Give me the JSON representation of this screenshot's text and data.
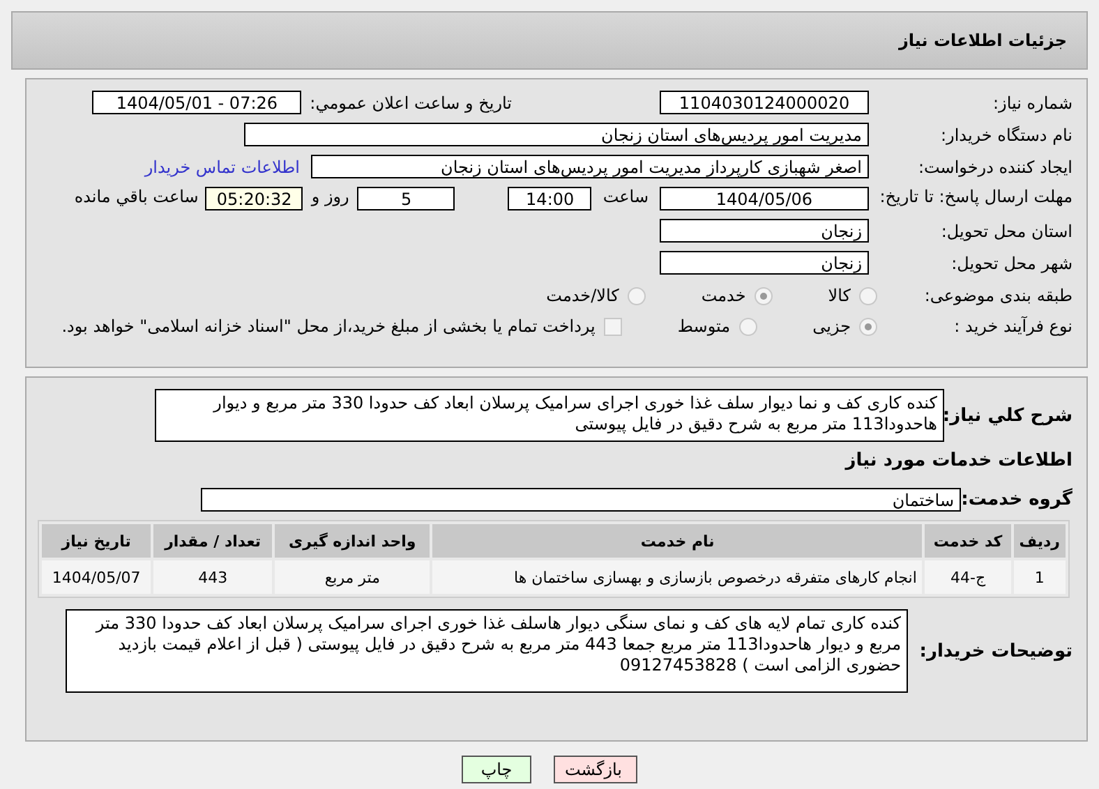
{
  "header": {
    "title": "جزئیات اطلاعات نیاز"
  },
  "need_number": {
    "label": "شماره نیاز:",
    "value": "1104030124000020"
  },
  "announce": {
    "label": "تاریخ و ساعت اعلان عمومي:",
    "value": "1404/05/01 - 07:26"
  },
  "buyer": {
    "label": "نام دستگاه خریدار:",
    "value": "مدیریت امور پردیس‌های استان زنجان"
  },
  "requester": {
    "label": "ایجاد کننده درخواست:",
    "value": "اصغر  شهبازی  کارپرداز  مدیریت امور پردیس‌های استان زنجان",
    "link": "اطلاعات تماس خریدار"
  },
  "deadline": {
    "label": "مهلت ارسال پاسخ: تا تاریخ:",
    "date": "1404/05/06",
    "time_label": "ساعت",
    "time": "14:00",
    "days": "5",
    "days_label": "روز و",
    "remaining": "05:20:32",
    "remaining_label": "ساعت باقي مانده"
  },
  "province": {
    "label": "استان محل تحویل:",
    "value": "زنجان"
  },
  "city": {
    "label": "شهر محل تحویل:",
    "value": "زنجان"
  },
  "category": {
    "label": "طبقه بندی موضوعی:",
    "options": [
      {
        "label": "کالا",
        "selected": false
      },
      {
        "label": "خدمت",
        "selected": true
      },
      {
        "label": "کالا/خدمت",
        "selected": false
      }
    ]
  },
  "process": {
    "label": "نوع فرآیند خرید :",
    "options": [
      {
        "label": "جزیی",
        "selected": true
      },
      {
        "label": "متوسط",
        "selected": false
      }
    ],
    "payment": {
      "label": "پرداخت تمام یا بخشی از مبلغ خرید،از محل \"اسناد خزانه اسلامی\" خواهد بود.",
      "checked": false
    }
  },
  "description": {
    "label": "شرح کلي نیاز:",
    "value": "کنده کاری کف و نما دیوار سلف غذا خوری اجرای سرامیک پرسلان ابعاد کف حدودا 330 متر مربع و دیوار هاحدودا113 متر مربع به شرح دقیق در فایل پیوستی"
  },
  "services_title": "اطلاعات خدمات مورد نیاز",
  "service_group": {
    "label": "گروه خدمت:",
    "value": "ساختمان"
  },
  "table": {
    "columns": [
      "ردیف",
      "کد خدمت",
      "نام خدمت",
      "واحد اندازه گیری",
      "تعداد / مقدار",
      "تاریخ نیاز"
    ],
    "rows": [
      [
        "1",
        "ج-44",
        "انجام کارهای متفرقه درخصوص بازسازی و بهسازی ساختمان ها",
        "متر مربع",
        "443",
        "1404/05/07"
      ]
    ]
  },
  "notes": {
    "label": "توضیحات خریدار:",
    "value": "کنده کاری تمام لایه های کف و نمای سنگی دیوار هاسلف غذا خوری اجرای سرامیک پرسلان ابعاد کف حدودا 330 متر مربع و دیوار هاحدودا113 متر مربع جمعا 443 متر مربع به شرح دقیق در فایل پیوستی ( قبل از اعلام قیمت بازدید حضوری الزامی است ) 09127453828"
  },
  "buttons": [
    {
      "label": "بازگشت",
      "kind": "back"
    },
    {
      "label": "چاپ",
      "kind": "print"
    }
  ]
}
